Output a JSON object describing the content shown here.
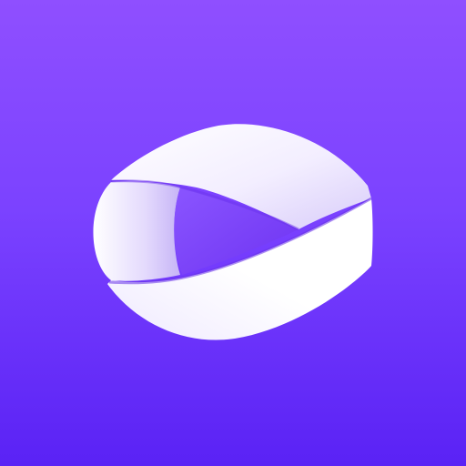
{
  "app_icon": {
    "icon_name": "play-ribbon-logo-icon",
    "colors": {
      "background_top": "#8F4FFF",
      "background_bottom": "#5A22F5",
      "ribbon_light": "#FFFFFF",
      "ribbon_shade": "#CDBEF7",
      "play_triangle": "#7A3FF8"
    }
  }
}
